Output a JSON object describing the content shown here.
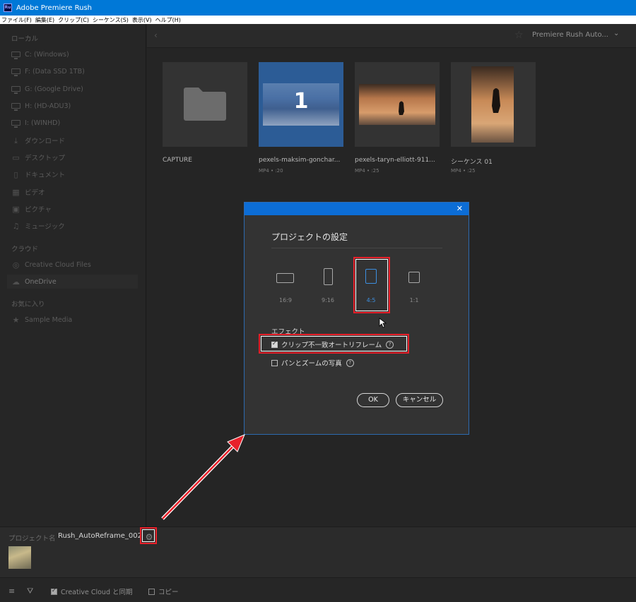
{
  "window": {
    "app_icon_text": "Ru",
    "title": "Adobe Premiere Rush"
  },
  "menu": [
    "ファイル(F)",
    "編集(E)",
    "クリップ(C)",
    "シーケンス(S)",
    "表示(V)",
    "ヘルプ(H)"
  ],
  "sidebar": {
    "local_header": "ローカル",
    "local_items": [
      {
        "label": "C: (Windows)",
        "icon": "drive-icon"
      },
      {
        "label": "F: (Data SSD 1TB)",
        "icon": "drive-icon"
      },
      {
        "label": "G: (Google Drive)",
        "icon": "drive-icon"
      },
      {
        "label": "H: (HD-ADU3)",
        "icon": "drive-icon"
      },
      {
        "label": "I: (WINHD)",
        "icon": "drive-icon"
      },
      {
        "label": "ダウンロード",
        "icon": "download-icon"
      },
      {
        "label": "デスクトップ",
        "icon": "desktop-icon"
      },
      {
        "label": "ドキュメント",
        "icon": "document-icon"
      },
      {
        "label": "ビデオ",
        "icon": "video-icon"
      },
      {
        "label": "ピクチャ",
        "icon": "picture-icon"
      },
      {
        "label": "ミュージック",
        "icon": "music-icon"
      }
    ],
    "cloud_header": "クラウド",
    "cloud_items": [
      {
        "label": "Creative Cloud Files",
        "icon": "creative-cloud-icon"
      },
      {
        "label": "OneDrive",
        "icon": "cloud-icon"
      }
    ],
    "favorites_header": "お気に入り",
    "favorite_items": [
      {
        "label": "Sample Media",
        "icon": "star-icon"
      }
    ]
  },
  "browser": {
    "location": "Premiere Rush Auto...",
    "items": [
      {
        "name": "CAPTURE",
        "meta": "",
        "kind": "folder"
      },
      {
        "name": "pexels-maksim-gonchar...",
        "meta": "MP4 • :20",
        "kind": "video",
        "badge": "1",
        "selected": true
      },
      {
        "name": "pexels-taryn-elliott-911...",
        "meta": "MP4 • :25",
        "kind": "video"
      },
      {
        "name": "シーケンス 01",
        "meta": "MP4 • :25",
        "kind": "sequence"
      }
    ]
  },
  "dialog": {
    "title": "プロジェクトの設定",
    "aspect_ratios": [
      "16:9",
      "9:16",
      "4:5",
      "1:1"
    ],
    "selected_ratio": "4:5",
    "effects_label": "エフェクト",
    "options": [
      {
        "label": "クリップ不一致オートリフレーム",
        "checked": true
      },
      {
        "label": "パンとズームの写真",
        "checked": false
      }
    ],
    "ok": "OK",
    "cancel": "キャンセル"
  },
  "project": {
    "label": "プロジェクト名",
    "name": "Rush_AutoReframe_002"
  },
  "bottom": {
    "sync_label": "Creative Cloud と同期",
    "sync_checked": true,
    "copy_label": "コピー",
    "copy_checked": false
  },
  "colors": {
    "accent": "#0c6dd6",
    "selected_ratio": "#3d8fe0",
    "annotation": "#e8202a"
  }
}
